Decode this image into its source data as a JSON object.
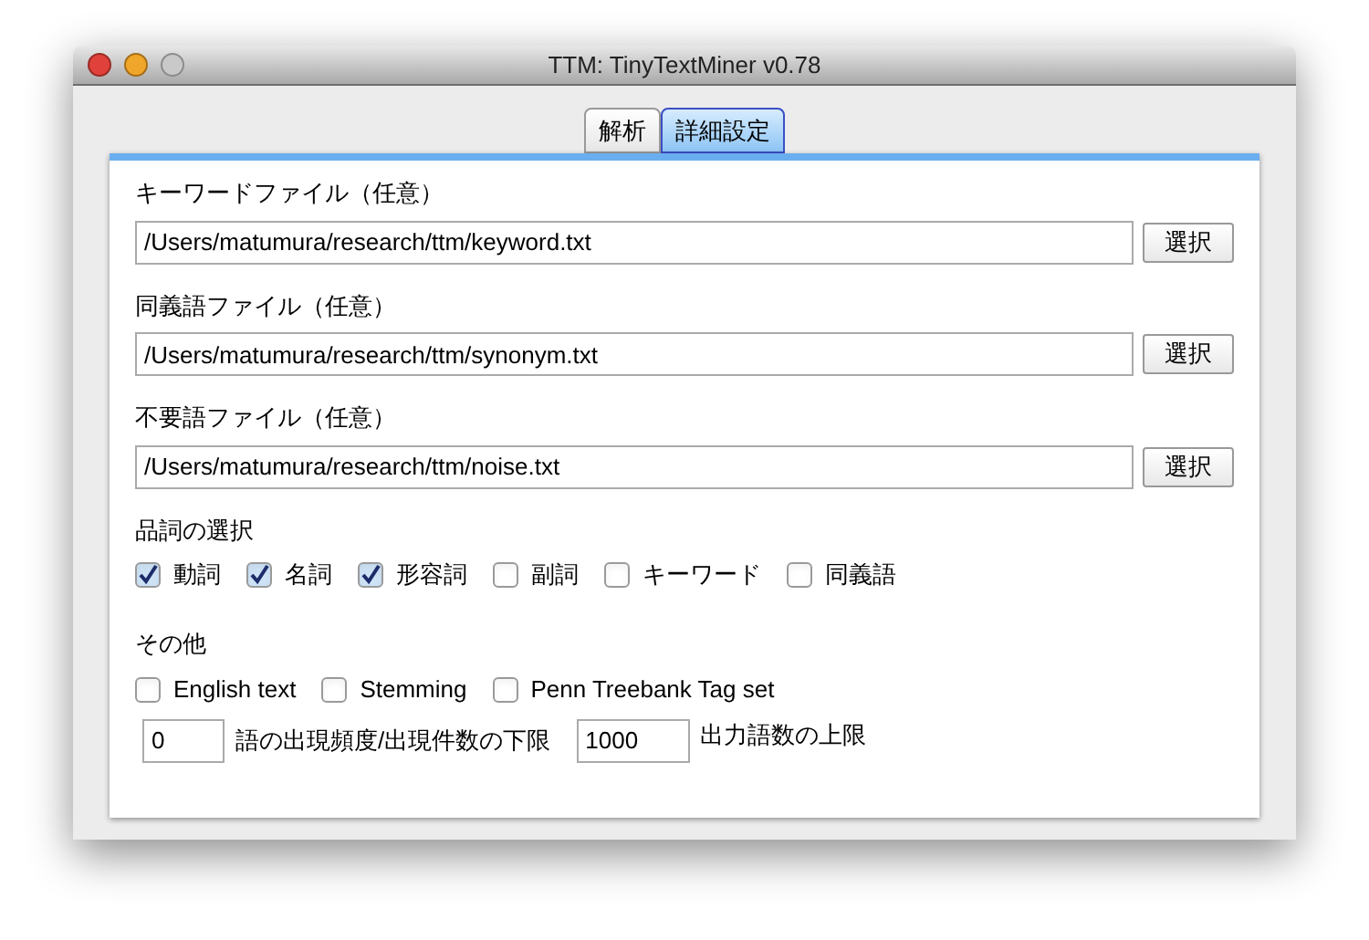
{
  "window": {
    "title": "TTM: TinyTextMiner v0.78"
  },
  "tabs": [
    {
      "label": "解析",
      "selected": false
    },
    {
      "label": "詳細設定",
      "selected": true
    }
  ],
  "files": [
    {
      "label": "キーワードファイル（任意）",
      "value": "/Users/matumura/research/ttm/keyword.txt",
      "button": "選択"
    },
    {
      "label": "同義語ファイル（任意）",
      "value": "/Users/matumura/research/ttm/synonym.txt",
      "button": "選択"
    },
    {
      "label": "不要語ファイル（任意）",
      "value": "/Users/matumura/research/ttm/noise.txt",
      "button": "選択"
    }
  ],
  "pos": {
    "title": "品詞の選択",
    "options": [
      {
        "label": "動詞",
        "checked": true
      },
      {
        "label": "名詞",
        "checked": true
      },
      {
        "label": "形容詞",
        "checked": true
      },
      {
        "label": "副詞",
        "checked": false
      },
      {
        "label": "キーワード",
        "checked": false
      },
      {
        "label": "同義語",
        "checked": false
      }
    ]
  },
  "other": {
    "title": "その他",
    "options": [
      {
        "label": "English text",
        "checked": false
      },
      {
        "label": "Stemming",
        "checked": false
      },
      {
        "label": "Penn Treebank Tag set",
        "checked": false
      }
    ],
    "min_freq": {
      "value": "0",
      "label": "語の出現頻度/出現件数の下限"
    },
    "max_words": {
      "value": "1000",
      "label": "出力語数の上限"
    }
  }
}
